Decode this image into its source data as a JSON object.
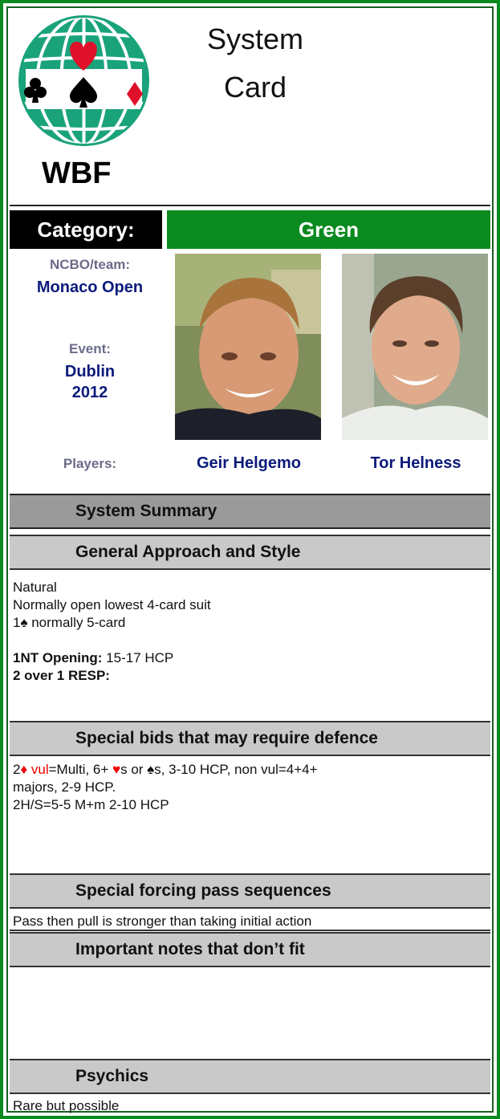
{
  "header": {
    "logo_text": "WBF",
    "title_line1": "System",
    "title_line2": "Card"
  },
  "category": {
    "label": "Category:",
    "value": "Green"
  },
  "info": {
    "ncbo_label": "NCBO/team:",
    "ncbo_value": "Monaco Open",
    "event_label": "Event:",
    "event_line1": "Dublin",
    "event_line2": "2012",
    "players_label": "Players:",
    "player1": "Geir Helgemo",
    "player2": "Tor Helness"
  },
  "summary": {
    "title": "System Summary"
  },
  "general": {
    "title": "General Approach and Style",
    "line1": "Natural",
    "line2": "Normally open lowest 4-card suit",
    "line3_suit": "1♠",
    "line3_rest": " normally 5-card",
    "nt_label": "1NT Opening:",
    "nt_value": " 15-17 HCP",
    "two_over_one": "2 over 1 RESP:"
  },
  "special_bids": {
    "title": "Special bids that may require defence",
    "p1_a": "2",
    "p1_diamond": "♦",
    "p1_vul": " vul",
    "p1_b": "=Multi, 6+ ",
    "p1_heart": "♥",
    "p1_c": "s or ♠s, 3-10 HCP, non vul=4+4+",
    "p1_d": "majors, 2-9 HCP.",
    "p2": "2H/S=5-5 M+m 2-10 HCP"
  },
  "forcing_pass": {
    "title": "Special forcing pass sequences",
    "text": "Pass then pull is stronger than taking initial action"
  },
  "notes": {
    "title": "Important notes that don’t fit",
    "text": ""
  },
  "psychics": {
    "title": "Psychics",
    "text": "Rare but possible"
  }
}
